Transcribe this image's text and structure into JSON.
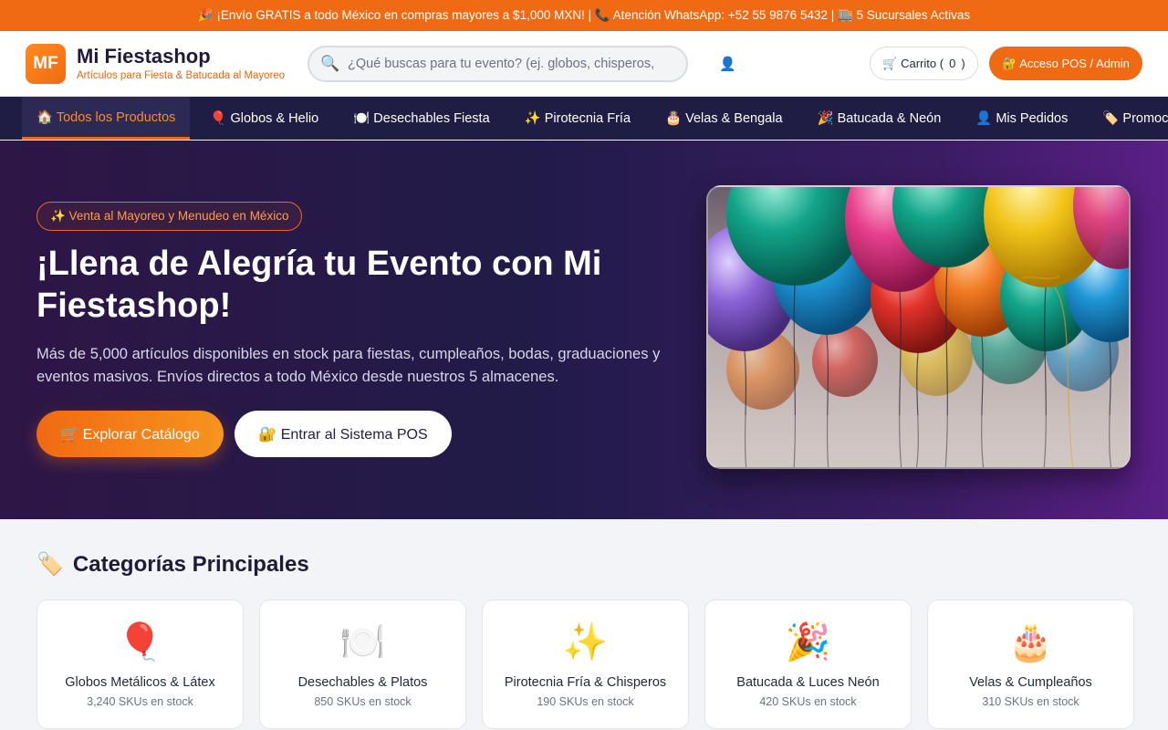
{
  "topbar": {
    "text": "🎉 ¡Envío GRATIS a todo México en compras mayores a $1,000 MXN! | 📞 Atención WhatsApp: +52 55 9876 5432 | 🏬 5 Sucursales Activas"
  },
  "header": {
    "logo_initials": "MF",
    "brand_name": "Mi Fiestashop",
    "tagline": "Artículos para Fiesta & Batucada al Mayoreo",
    "search_placeholder": "¿Qué buscas para tu evento? (ej. globos, chisperos, confeti)",
    "search_icon": "🔍",
    "user_icon": "👤",
    "cart_label": "🛒 Carrito (",
    "cart_count": "0",
    "cart_close": ")",
    "pos_label": "🔐 Acceso POS / Admin"
  },
  "nav": [
    {
      "label": "🏠 Todos los Productos"
    },
    {
      "label": "🎈 Globos & Helio"
    },
    {
      "label": "🍽️ Desechables Fiesta"
    },
    {
      "label": "✨ Pirotecnia Fría"
    },
    {
      "label": "🎂 Velas & Bengala"
    },
    {
      "label": "🎉 Batucada & Neón"
    },
    {
      "label": "👤 Mis Pedidos"
    },
    {
      "label": "🏷️ Promociones & Ofertas"
    }
  ],
  "hero": {
    "badge": "✨ Venta al Mayoreo y Menudeo en México",
    "title": "¡Llena de Alegría tu Evento con Mi Fiestashop!",
    "subtitle": "Más de 5,000 artículos disponibles en stock para fiestas, cumpleaños, bodas, graduaciones y eventos masivos. Envíos directos a todo México desde nuestros 5 almacenes.",
    "btn_explore": "🛒 Explorar Catálogo",
    "btn_pos": "🔐 Entrar al Sistema POS"
  },
  "categories": {
    "icon": "🏷️",
    "title": "Categorías Principales",
    "items": [
      {
        "icon": "🎈",
        "name": "Globos Metálicos & Látex",
        "count": "3,240 SKUs en stock"
      },
      {
        "icon": "🍽️",
        "name": "Desechables & Platos",
        "count": "850 SKUs en stock"
      },
      {
        "icon": "✨",
        "name": "Pirotecnia Fría & Chisperos",
        "count": "190 SKUs en stock"
      },
      {
        "icon": "🎉",
        "name": "Batucada & Luces Neón",
        "count": "420 SKUs en stock"
      },
      {
        "icon": "🎂",
        "name": "Velas & Cumpleaños",
        "count": "310 SKUs en stock"
      }
    ]
  },
  "colors": {
    "accent": "#f06a13",
    "nav_bg": "#1f1d44",
    "hero_bg": "#211b48"
  }
}
